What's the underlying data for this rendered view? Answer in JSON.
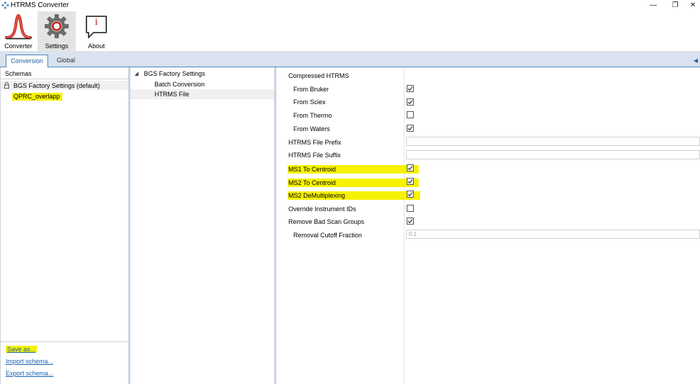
{
  "window": {
    "title": "HTRMS Converter",
    "controls": {
      "minimize": "—",
      "restore": "❐",
      "close": "✕"
    }
  },
  "ribbon": {
    "buttons": [
      {
        "label": "Converter",
        "icon": "peak-icon"
      },
      {
        "label": "Settings",
        "icon": "gear-icon",
        "active": true
      },
      {
        "label": "About",
        "icon": "info-icon",
        "icon_text": "i"
      }
    ]
  },
  "tabs": [
    {
      "label": "Conversion",
      "active": true
    },
    {
      "label": "Global",
      "active": false
    }
  ],
  "schemas": {
    "header": "Schemas",
    "items": [
      {
        "label": "BGS Factory Settings (default)",
        "lock": true
      },
      {
        "label": "QPRC_overlapp"
      }
    ],
    "links": {
      "save_as": "Save as...",
      "import": "Import schema...",
      "export": "Export schema..."
    }
  },
  "tree": {
    "root": "BGS Factory Settings",
    "children": [
      "Batch Conversion",
      "HTRMS File"
    ]
  },
  "properties": {
    "compressed_htrms": "Compressed HTRMS",
    "from_bruker": "From Bruker",
    "from_sciex": "From Sciex",
    "from_thermo": "From Thermo",
    "from_waters": "From Waters",
    "prefix": "HTRMS File Prefix",
    "suffix": "HTRMS File Suffix",
    "ms1_centroid": "MS1 To Centroid",
    "ms2_centroid": "MS2 To Centroid",
    "ms2_demux": "MS2 DeMultiplexing",
    "override_ids": "Override Instrument IDs",
    "remove_bad": "Remove Bad Scan Groups",
    "removal_cutoff": "Removal Cutoff Fraction",
    "removal_cutoff_value": "0.1",
    "checks": {
      "from_bruker": true,
      "from_sciex": true,
      "from_thermo": false,
      "from_waters": true,
      "ms1_centroid": true,
      "ms2_centroid": true,
      "ms2_demux": true,
      "override_ids": false,
      "remove_bad": true
    }
  },
  "colors": {
    "highlight": "#f6f200",
    "accent": "#4a86c5",
    "link": "#1a5fb4"
  }
}
